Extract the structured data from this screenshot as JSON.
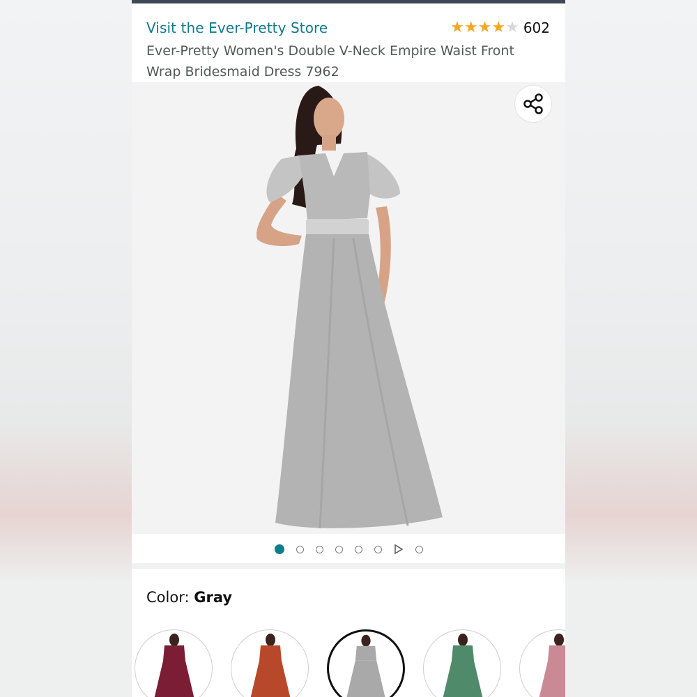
{
  "header": {
    "store_link": "Visit the Ever-Pretty Store",
    "rating_stars": 4,
    "rating_max": 5,
    "review_count": "602",
    "title": "Ever-Pretty Women's Double V-Neck Empire Waist Front Wrap Bridesmaid Dress 7962"
  },
  "gallery": {
    "share_icon": "share-icon",
    "active_index": 0,
    "slides": [
      "image",
      "image",
      "image",
      "image",
      "image",
      "image",
      "video",
      "image"
    ]
  },
  "color": {
    "label": "Color:",
    "value": "Gray"
  },
  "swatches": [
    {
      "color": "#7a1d35",
      "selected": false
    },
    {
      "color": "#b8482a",
      "selected": false
    },
    {
      "color": "#a9a9a9",
      "selected": true
    },
    {
      "color": "#4f8a6a",
      "selected": false
    },
    {
      "color": "#c98a95",
      "selected": false
    }
  ]
}
